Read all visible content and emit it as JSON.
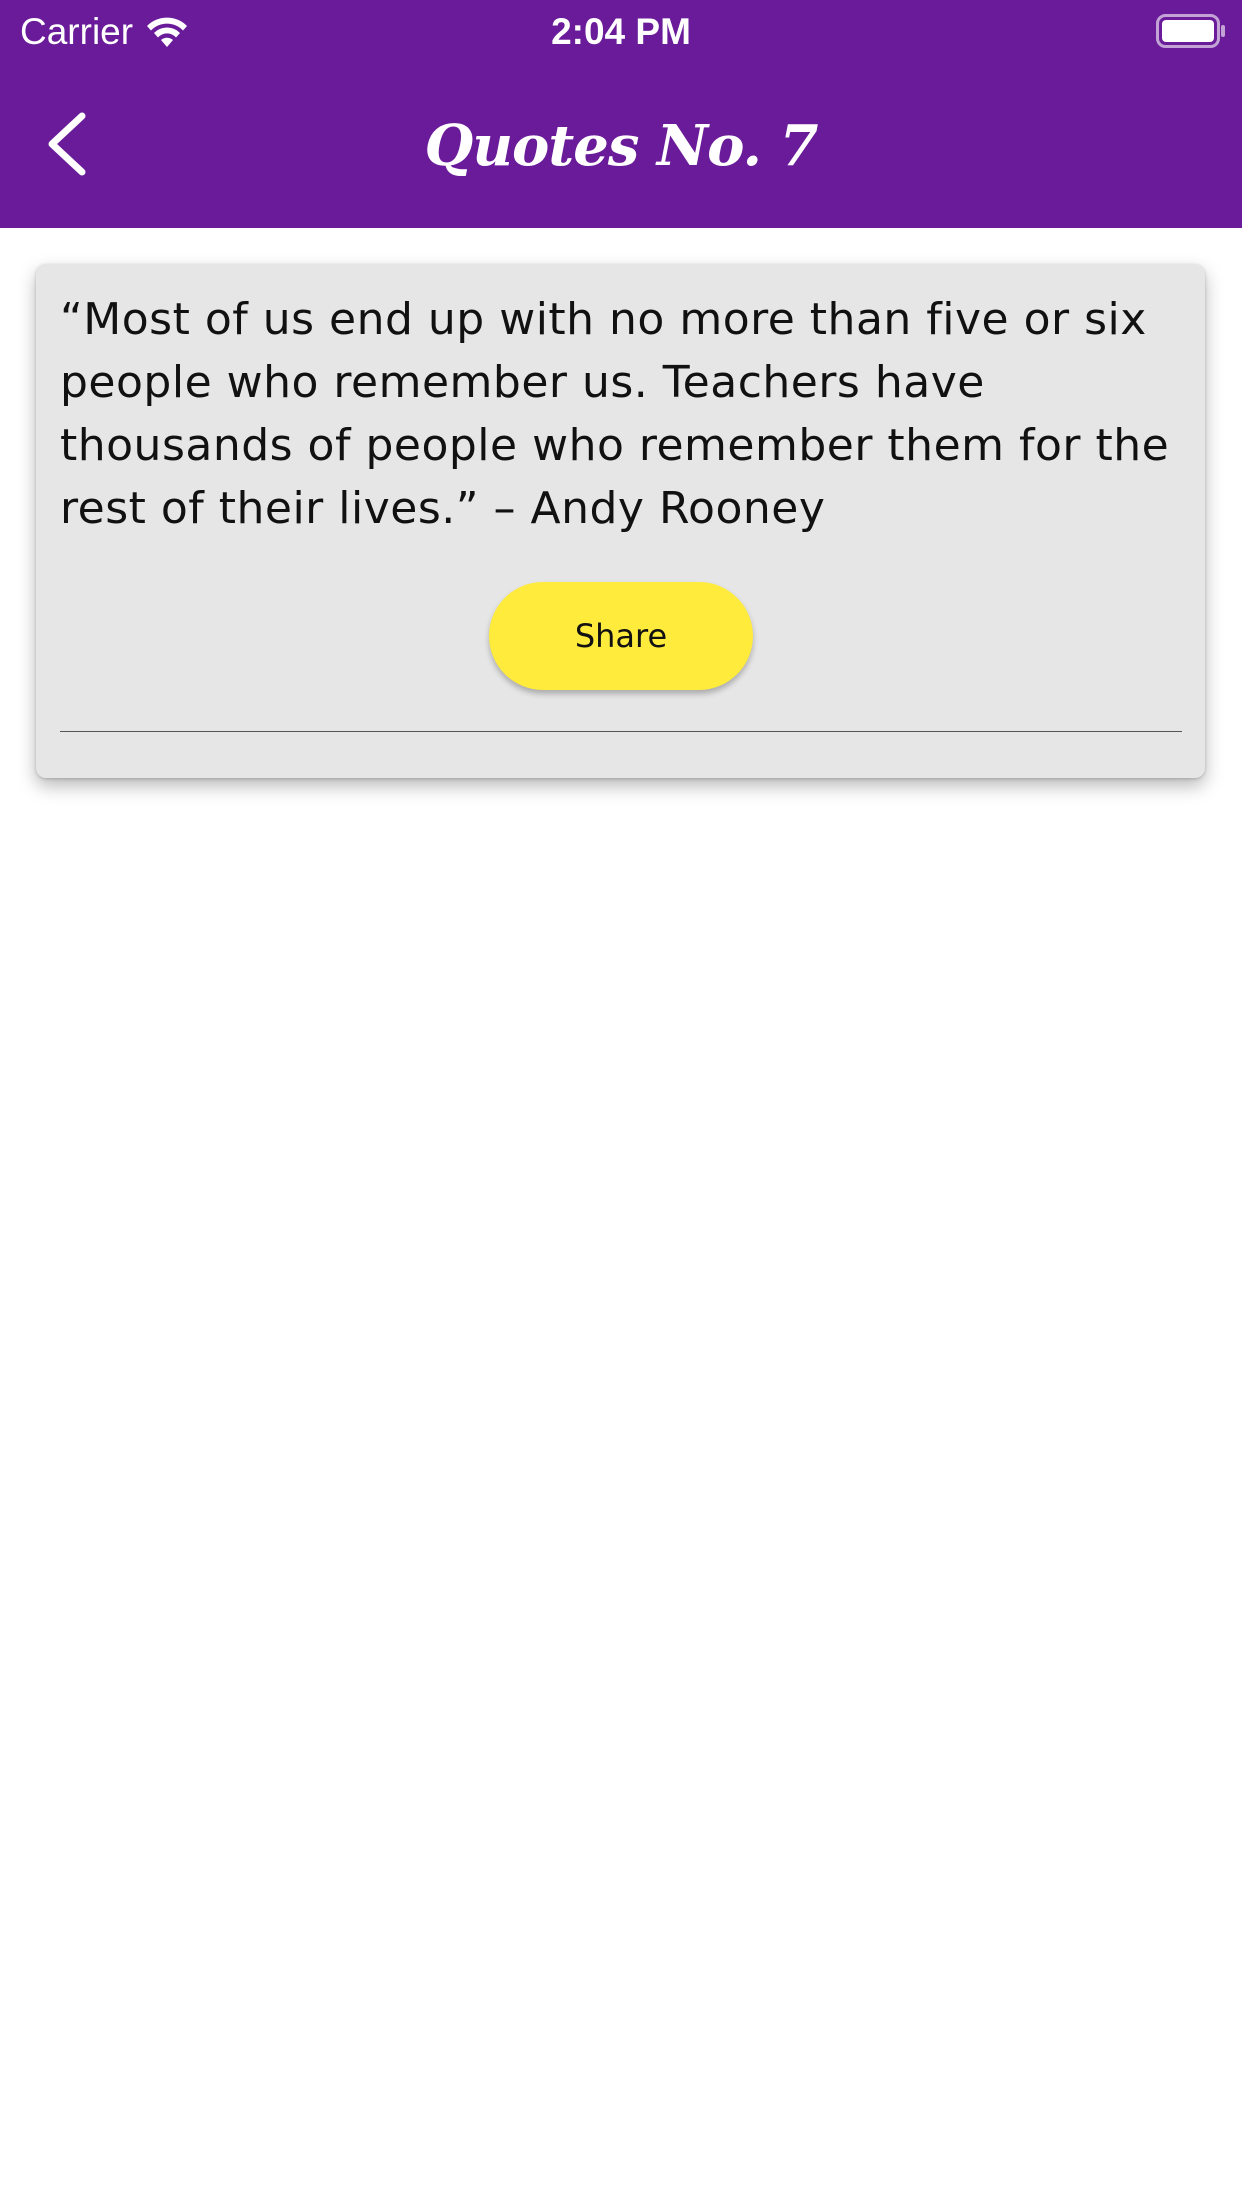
{
  "status_bar": {
    "carrier": "Carrier",
    "time": "2:04 PM",
    "wifi_icon": "wifi-icon",
    "battery_icon": "battery-full-icon"
  },
  "nav": {
    "title": "Quotes No. 7",
    "back_icon": "chevron-left-icon"
  },
  "quote_card": {
    "text": "“Most of us end up with no more than five or six people who remember us. Teachers have thousands of people who remember them for the rest of their lives.” – Andy Rooney",
    "share_label": "Share"
  },
  "colors": {
    "primary": "#6a1b9a",
    "card_background": "#e6e6e7",
    "share_button": "#ffeb3b"
  }
}
